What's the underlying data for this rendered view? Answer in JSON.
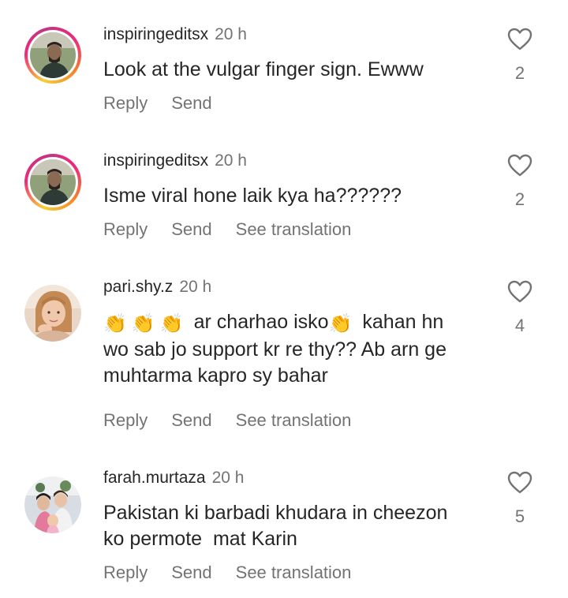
{
  "comments": [
    {
      "username": "inspiringeditsx",
      "time": "20 h",
      "text": "Look at the vulgar finger sign. Ewww",
      "likes": "2",
      "actions": [
        "Reply",
        "Send"
      ],
      "avatar": "avatar-man"
    },
    {
      "username": "inspiringeditsx",
      "time": "20 h",
      "text": "Isme viral hone laik kya ha??????",
      "likes": "2",
      "actions": [
        "Reply",
        "Send",
        "See translation"
      ],
      "avatar": "avatar-man"
    },
    {
      "username": "pari.shy.z",
      "time": "20 h",
      "text_lines": [
        "ar charhao isko",
        "kahan hn",
        "wo sab jo support kr re thy?? Ab arn ge",
        "muhtarma kapro sy bahar"
      ],
      "likes": "4",
      "actions": [
        "Reply",
        "Send",
        "See translation"
      ],
      "avatar": "avatar-girl"
    },
    {
      "username": "farah.murtaza",
      "time": "20 h",
      "text_lines": [
        "Pakistan ki barbadi khudara in cheezon",
        "ko permote  mat Karin"
      ],
      "likes": "5",
      "actions": [
        "Reply",
        "Send",
        "See translation"
      ],
      "avatar": "avatar-group"
    }
  ],
  "icons": {
    "like": "heart-outline-icon",
    "clap": "clapping-hands-emoji"
  },
  "colors": {
    "primary_text": "#262626",
    "secondary_text": "#737373",
    "story_ring": [
      "#f9ce34",
      "#ee2a7b",
      "#c13584"
    ]
  }
}
